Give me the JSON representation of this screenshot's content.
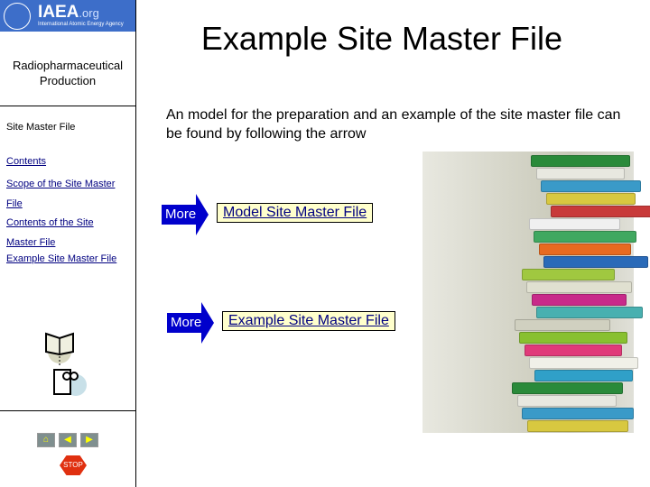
{
  "logo": {
    "text": "IAEA",
    "suffix": ".org",
    "subtitle": "International Atomic Energy Agency"
  },
  "sidebar": {
    "subject": "Radiopharmaceutical Production",
    "section": "Site Master File",
    "nav": [
      {
        "label": "Contents"
      },
      {
        "label": "Scope of the Site Master File"
      },
      {
        "label": "Contents of the Site Master File"
      },
      {
        "label": "Example Site Master File"
      }
    ],
    "controls": {
      "stop": "STOP",
      "home": "home",
      "back": "back",
      "forward": "forward"
    }
  },
  "main": {
    "title": "Example Site Master File",
    "intro": "An model for the preparation and an example of the site master file can be found by following the arrow",
    "links": [
      {
        "arrow": "More",
        "label": "Model Site Master File"
      },
      {
        "arrow": "More",
        "label": "Example Site Master File"
      }
    ]
  },
  "colors": {
    "logo_bg": "#3d6ec9",
    "arrow": "#0000cc",
    "link_bg": "#ffffcc",
    "link_text": "#000080"
  }
}
